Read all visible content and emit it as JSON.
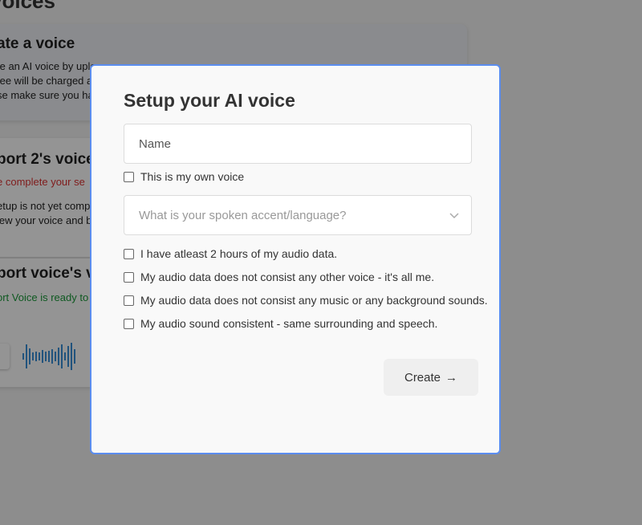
{
  "background": {
    "page_title": "voices",
    "cards": [
      {
        "title": "ate a voice",
        "lines": [
          "te an AI voice by uplo",
          "fee will be charged a",
          "se make sure you hav"
        ]
      },
      {
        "title": "port 2's voice",
        "warning": "e complete your se",
        "lines": [
          "etup is not yet comple",
          "iew your voice and be"
        ]
      },
      {
        "title": "port voice's vo",
        "status_name": "ort Voice",
        "status_rest": " is ready to"
      }
    ]
  },
  "modal": {
    "title": "Setup your AI voice",
    "name_placeholder": "Name",
    "own_voice_label": "This is my own voice",
    "accent_placeholder": "What is your spoken accent/language?",
    "checks": [
      "I have atleast 2 hours of my audio data.",
      "My audio data does not consist any other voice - it's all me.",
      "My audio data does not consist any music or any background sounds.",
      "My audio sound consistent - same surrounding and speech."
    ],
    "create_label": "Create",
    "create_arrow": "→"
  },
  "colors": {
    "accent": "#5b8def",
    "wave": "#3a8fd8"
  }
}
